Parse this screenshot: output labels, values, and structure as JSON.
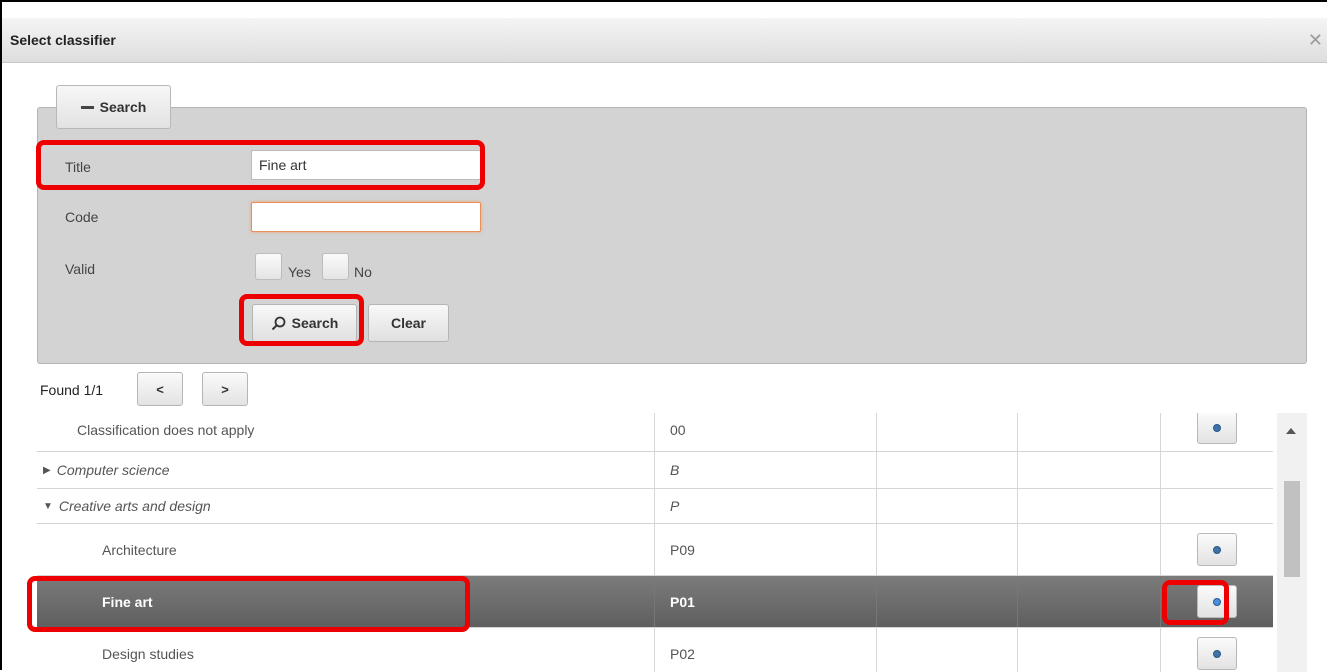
{
  "dialog": {
    "title": "Select classifier",
    "close_glyph": "✕"
  },
  "search_panel": {
    "toggle_label": "Search",
    "fields": {
      "title_label": "Title",
      "title_value": "Fine art",
      "code_label": "Code",
      "code_value": "",
      "valid_label": "Valid",
      "yes_label": "Yes",
      "no_label": "No"
    },
    "search_button_label": "Search",
    "clear_button_label": "Clear"
  },
  "results": {
    "found_text": "Found 1/1",
    "prev_label": "<",
    "next_label": ">"
  },
  "table": {
    "rows": [
      {
        "title": "Classification does not apply",
        "code": "00",
        "has_button": true,
        "type": "leaf"
      },
      {
        "title": "Computer science",
        "code": "B",
        "has_button": false,
        "type": "group-collapsed"
      },
      {
        "title": "Creative arts and design",
        "code": "P",
        "has_button": false,
        "type": "group-expanded"
      },
      {
        "title": "Architecture",
        "code": "P09",
        "has_button": true,
        "type": "child"
      },
      {
        "title": "Fine art",
        "code": "P01",
        "has_button": true,
        "type": "child-selected"
      },
      {
        "title": "Design studies",
        "code": "P02",
        "has_button": true,
        "type": "child"
      }
    ]
  },
  "colors": {
    "highlight": "#ee0000",
    "selected_row": "#6e6e6e",
    "panel_bg": "#d3d3d3"
  }
}
